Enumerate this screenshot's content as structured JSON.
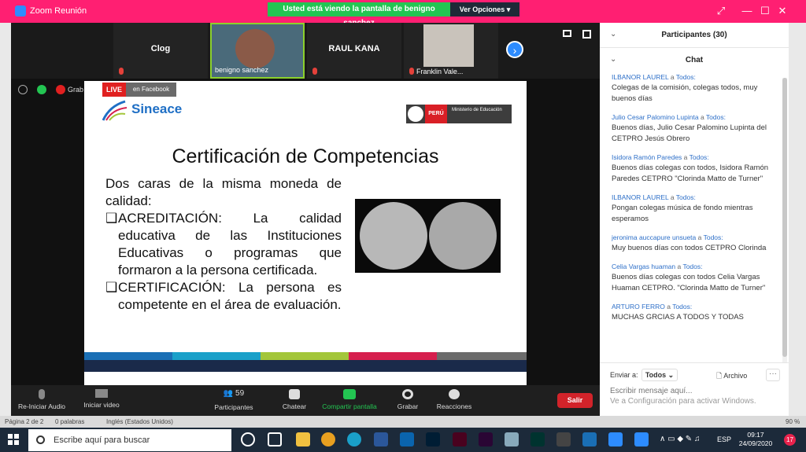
{
  "window": {
    "title": "Zoom Reunión",
    "share_banner": "Usted está viendo la pantalla de benigno sanchez",
    "view_options": "Ver Opciones"
  },
  "video_strip": {
    "tiles": [
      {
        "name": "Clog",
        "muted": true
      },
      {
        "name": "benigno sanchez",
        "muted": false
      },
      {
        "name": "RAUL KANA",
        "muted": true
      },
      {
        "name": "Franklin Vale...",
        "muted": true
      }
    ]
  },
  "share_info": {
    "recording_label": "Grab"
  },
  "slide": {
    "live_label": "LIVE",
    "facebook_label": "en Facebook",
    "sineace_logo": "Sineace",
    "minedu_peru": "PERÚ",
    "minedu_text": "Ministerio de Educación",
    "title": "Certificación de Competencias",
    "intro": "Dos caras de la misma moneda de calidad:",
    "bullets": [
      {
        "keyword": "ACREDITACIÓN",
        "text": ": La calidad educativa de las Instituciones Educativas o programas que formaron a la persona certificada."
      },
      {
        "keyword": "CERTIFICACIÓN",
        "text": ": La persona es competente en el área de evaluación."
      }
    ],
    "stripe_colors": [
      "#1a6fb5",
      "#1aa0c9",
      "#a3c63a",
      "#d61f4e",
      "#6b6b6b"
    ]
  },
  "right_panel": {
    "participants_label": "Participantes (30)",
    "chat_label": "Chat",
    "messages": [
      {
        "from": "ILBANOR LAUREL",
        "to": "Todos",
        "text": "Colegas de la comisión, colegas todos, muy buenos días"
      },
      {
        "from": "Julio Cesar Palomino Lupinta",
        "to": "Todos",
        "text": "Buenos días, Julio Cesar Palomino Lupinta del CETPRO Jesús Obrero"
      },
      {
        "from": "Isidora Ramón Paredes",
        "to": "Todos",
        "text": "Buenos días colegas con todos, Isidora Ramón Paredes CETPRO \"Clorinda Matto de Turner\""
      },
      {
        "from": "ILBANOR LAUREL",
        "to": "Todos",
        "text": "Pongan colegas música de fondo mientras esperamos"
      },
      {
        "from": "jeronima auccapure unsueta",
        "to": "Todos",
        "text": "Muy buenos días con todos CETPRO Clorinda"
      },
      {
        "from": "Celia Vargas huaman",
        "to": "Todos",
        "text": "Buenos días colegas con todos Celia Vargas Huaman CETPRO. \"Clorinda Matto de Turner\""
      },
      {
        "from": "ARTURO FERRO",
        "to": "Todos",
        "text": "MUCHAS GRCIAS A TODOS Y TODAS"
      }
    ],
    "a_word": "a",
    "send_to_label": "Enviar a:",
    "send_to_value": "Todos",
    "file_label": "Archivo",
    "more_label": "···",
    "input_placeholder": "Escribir mensaje aquí...",
    "activation_text": "Ve a Configuración para activar Windows.",
    "activation_title": "Activar Windows"
  },
  "toolbar": {
    "audio": "Re-Iniciar Audio",
    "video": "Iniciar video",
    "participants": "Participantes",
    "participants_count": "59",
    "chat": "Chatear",
    "share": "Compartir pantalla",
    "record": "Grabar",
    "reactions": "Reacciones",
    "leave": "Salir"
  },
  "statusbar": {
    "page": "Página 2 de 2",
    "words": "0 palabras",
    "language": "Inglés (Estados Unidos)",
    "zoom": "90 %"
  },
  "taskbar": {
    "search_placeholder": "Escribe aquí para buscar",
    "lang": "ESP",
    "time": "09:17",
    "date": "24/09/2020",
    "notifications": "17"
  }
}
